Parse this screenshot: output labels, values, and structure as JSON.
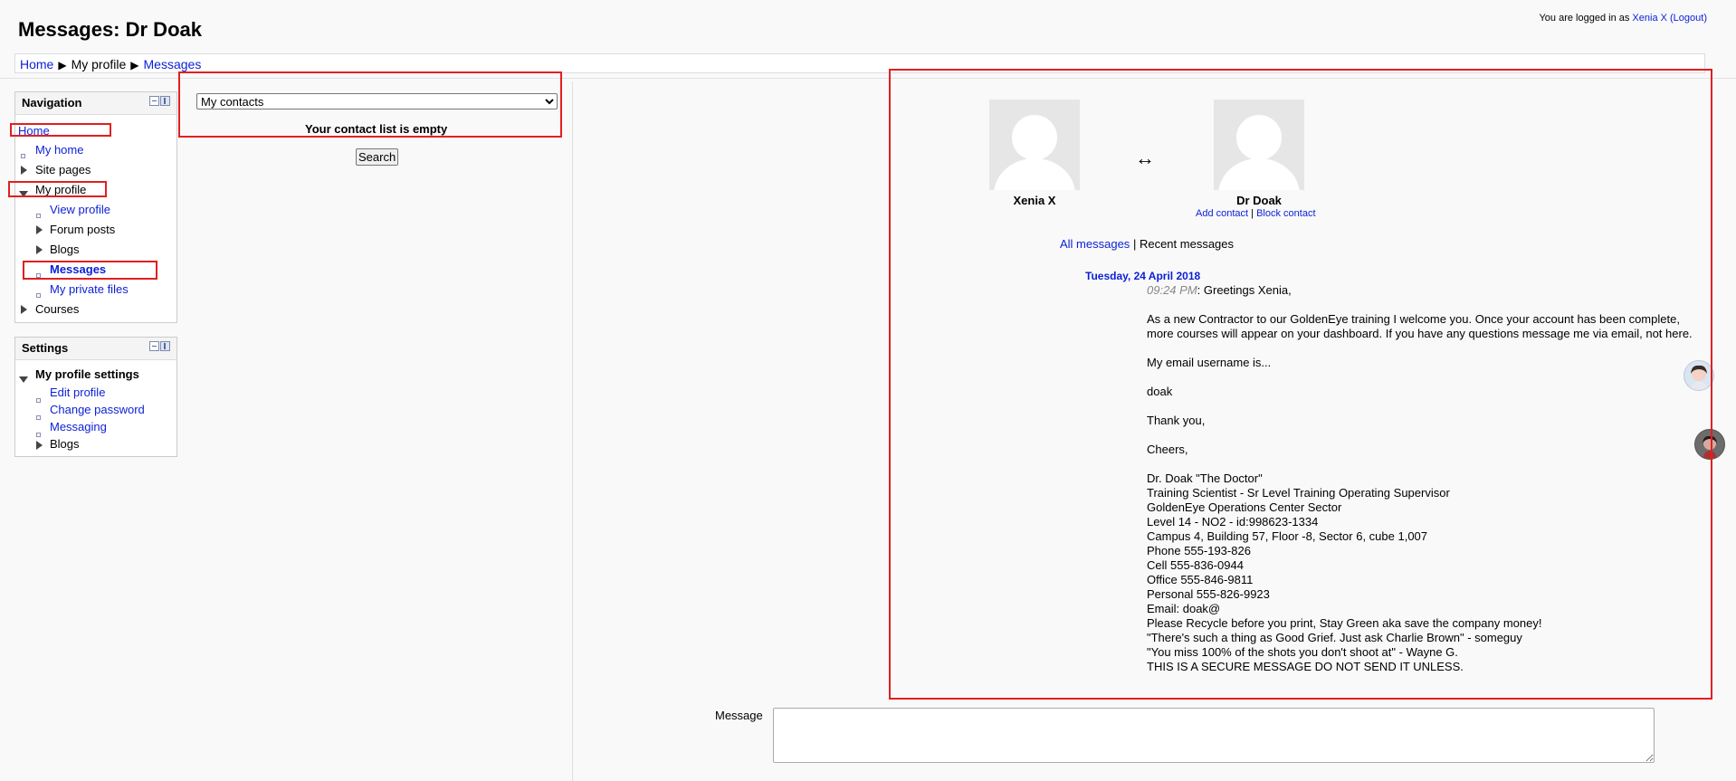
{
  "page": {
    "title": "Messages: Dr Doak",
    "login_prefix": "You are logged in as ",
    "login_user": "Xenia X",
    "logout_label": "(Logout)"
  },
  "breadcrumb": {
    "items": [
      "Home",
      "My profile",
      "Messages"
    ]
  },
  "navigation": {
    "title": "Navigation",
    "home": "Home",
    "my_home": "My home",
    "site_pages": "Site pages",
    "my_profile": "My profile",
    "view_profile": "View profile",
    "forum_posts": "Forum posts",
    "blogs": "Blogs",
    "messages": "Messages",
    "my_private_files": "My private files",
    "courses": "Courses"
  },
  "settings": {
    "title": "Settings",
    "my_profile_settings": "My profile settings",
    "edit_profile": "Edit profile",
    "change_password": "Change password",
    "messaging": "Messaging",
    "blogs": "Blogs"
  },
  "contacts": {
    "selected": "My contacts",
    "empty_text": "Your contact list is empty",
    "search_button": "Search"
  },
  "conversation": {
    "user_a": "Xenia X",
    "user_b": "Dr Doak",
    "add_contact": "Add contact",
    "block_contact": "Block contact",
    "separator": "|",
    "arrow": "↔",
    "all_messages": "All messages",
    "recent_messages": "Recent messages",
    "date": "Tuesday, 24 April 2018",
    "time": "09:24 PM",
    "greeting": ": Greetings Xenia,",
    "p1_line1": "As a new Contractor to our GoldenEye training I welcome you. Once your account has been complete,",
    "p1_line2": "more courses will appear on your dashboard. If you have any questions message me via email, not here.",
    "p2": "My email username is...",
    "p3": "doak",
    "p4": "Thank you,",
    "p5": "Cheers,",
    "sig": [
      "Dr. Doak \"The Doctor\"",
      "Training Scientist - Sr Level Training Operating Supervisor",
      "GoldenEye Operations Center Sector",
      "Level 14 - NO2 - id:998623-1334",
      "Campus 4, Building 57, Floor -8, Sector 6, cube 1,007",
      "Phone 555-193-826",
      "Cell 555-836-0944",
      "Office 555-846-9811",
      "Personal 555-826-9923",
      "Email: doak@",
      "Please Recycle before you print, Stay Green aka save the company money!",
      "\"There's such a thing as Good Grief. Just ask Charlie Brown\" - someguy",
      "\"You miss 100% of the shots you don't shoot at\" - Wayne G.",
      "THIS IS A SECURE MESSAGE DO NOT SEND IT UNLESS."
    ]
  },
  "compose": {
    "label": "Message",
    "value": ""
  },
  "colors": {
    "link": "#0b1fd6",
    "highlight_box": "#e02020"
  }
}
